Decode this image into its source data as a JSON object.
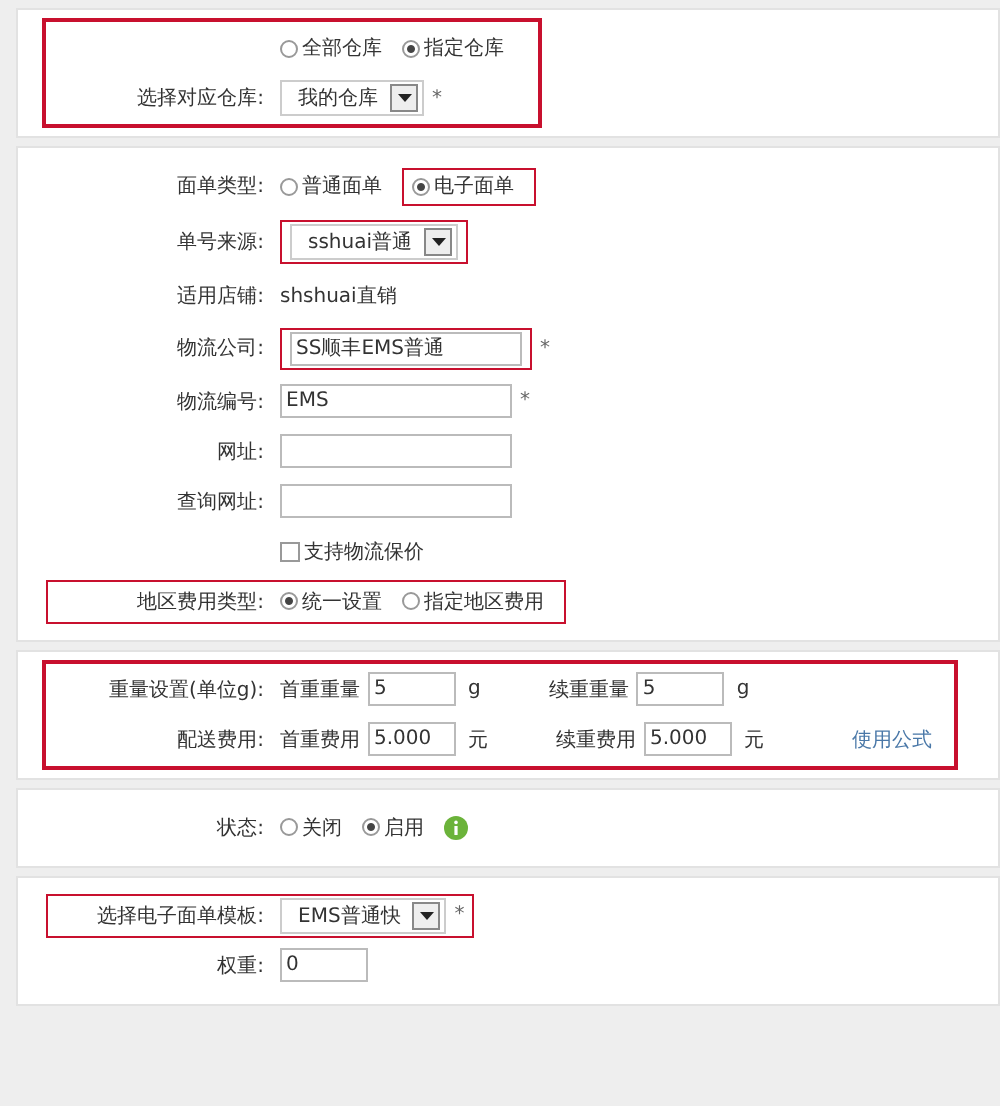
{
  "sections": [
    {
      "highlight": true,
      "rows": [
        {
          "label": "",
          "items": [
            {
              "kind": "radio",
              "label": "全部仓库",
              "selected": false
            },
            {
              "kind": "radio",
              "label": "指定仓库",
              "selected": true
            }
          ]
        },
        {
          "label": "选择对应仓库:",
          "items": [
            {
              "kind": "select",
              "value": "我的仓库"
            },
            {
              "kind": "required",
              "text": "*"
            }
          ]
        }
      ]
    },
    {
      "rows": [
        {
          "label": "面单类型:",
          "items": [
            {
              "kind": "radio",
              "label": "普通面单",
              "selected": false
            },
            {
              "kind": "radio",
              "label": "电子面单",
              "selected": true,
              "highlight": true
            }
          ]
        },
        {
          "label": "单号来源:",
          "items": [
            {
              "kind": "select",
              "value": "sshuai普通",
              "highlight": true
            }
          ]
        },
        {
          "label": "适用店铺:",
          "items": [
            {
              "kind": "text",
              "text": "shshuai直销"
            }
          ]
        },
        {
          "label": "物流公司:",
          "items": [
            {
              "kind": "input",
              "value": "SS顺丰EMS普通",
              "highlight": true
            },
            {
              "kind": "required",
              "text": "*"
            }
          ]
        },
        {
          "label": "物流编号:",
          "items": [
            {
              "kind": "input",
              "value": "EMS"
            },
            {
              "kind": "required",
              "text": "*"
            }
          ]
        },
        {
          "label": "网址:",
          "items": [
            {
              "kind": "input",
              "value": ""
            }
          ]
        },
        {
          "label": "查询网址:",
          "items": [
            {
              "kind": "input",
              "value": ""
            }
          ]
        },
        {
          "label": "",
          "items": [
            {
              "kind": "checkbox",
              "label": "支持物流保价",
              "checked": false
            }
          ]
        },
        {
          "label": "地区费用类型:",
          "highlight": true,
          "items": [
            {
              "kind": "radio",
              "label": "统一设置",
              "selected": true
            },
            {
              "kind": "radio",
              "label": "指定地区费用",
              "selected": false
            }
          ]
        }
      ]
    },
    {
      "highlight": true,
      "rows": [
        {
          "label": "重量设置(单位g):",
          "items": [
            {
              "kind": "text",
              "text": "首重重量"
            },
            {
              "kind": "small-input",
              "value": "5"
            },
            {
              "kind": "unit",
              "text": "g"
            },
            {
              "kind": "text",
              "text": "续重重量"
            },
            {
              "kind": "small-input",
              "value": "5"
            },
            {
              "kind": "unit",
              "text": "g"
            }
          ]
        },
        {
          "label": "配送费用:",
          "items": [
            {
              "kind": "text",
              "text": "首重费用"
            },
            {
              "kind": "small-input",
              "value": "5.000"
            },
            {
              "kind": "unit",
              "text": "元"
            },
            {
              "kind": "text",
              "text": "续重费用"
            },
            {
              "kind": "small-input",
              "value": "5.000"
            },
            {
              "kind": "unit",
              "text": "元"
            },
            {
              "kind": "link",
              "text": "使用公式"
            }
          ]
        }
      ]
    },
    {
      "rows": [
        {
          "label": "状态:",
          "items": [
            {
              "kind": "radio",
              "label": "关闭",
              "selected": false
            },
            {
              "kind": "radio",
              "label": "启用",
              "selected": true
            },
            {
              "kind": "info"
            }
          ]
        }
      ]
    },
    {
      "rows": [
        {
          "label": "选择电子面单模板:",
          "highlight": true,
          "items": [
            {
              "kind": "select",
              "value": "EMS普通快"
            },
            {
              "kind": "required",
              "text": "*"
            }
          ]
        },
        {
          "label": "权重:",
          "items": [
            {
              "kind": "small-input",
              "value": "0"
            }
          ]
        }
      ]
    }
  ]
}
